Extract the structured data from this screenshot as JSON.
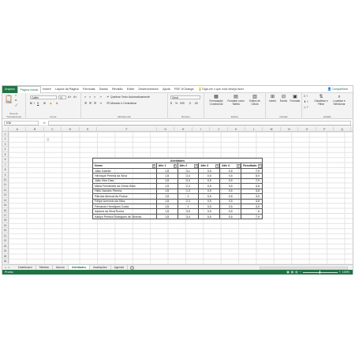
{
  "menu": {
    "file": "Arquivo",
    "tabs": [
      "Página Inicial",
      "Inserir",
      "Layout da Página",
      "Fórmulas",
      "Dados",
      "Revisão",
      "Exibir",
      "Desenvolvedor",
      "Ajuda",
      "PDF-XChange"
    ],
    "tell_me": "Diga-me o que você deseja fazer",
    "share": "Compartilhar"
  },
  "ribbon": {
    "paste": "Colar",
    "font_name": "Calibri",
    "font_size": "11",
    "wrap_text": "Quebrar Texto Automaticamente",
    "merge_center": "Mesclar e Centralizar",
    "number_format": "Geral",
    "conditional_format": "Formatação Condicional",
    "format_as_table": "Formatar como Tabela",
    "cell_styles": "Estilos de Célula",
    "insert": "Inserir",
    "delete": "Excluir",
    "format": "Formatar",
    "sort_filter": "Classificar e Filtrar",
    "find_select": "Localizar e Selecionar",
    "groups": [
      "Área de Transferência",
      "Fonte",
      "Alinhamento",
      "Número",
      "Estilos",
      "Células",
      "Edição"
    ]
  },
  "formula_bar": {
    "name_box": "K36",
    "fx": "fx",
    "content": ""
  },
  "columns": [
    "A",
    "B",
    "C",
    "D",
    "E",
    "F",
    "G",
    "H",
    "I",
    "J",
    "K",
    "L",
    "M",
    "N",
    "O",
    "P",
    "Q",
    "R",
    "S"
  ],
  "rows": [
    "1",
    "2",
    "3",
    "4",
    "5",
    "6",
    "7",
    "8",
    "9",
    "10",
    "11",
    "12",
    "13",
    "14",
    "15",
    "16",
    "17",
    "18",
    "19",
    "20",
    "21",
    "22",
    "23",
    "24",
    "25",
    "26"
  ],
  "sheet": {
    "title": "Atividades",
    "headers": [
      "Nome",
      "Ativ 1",
      "Ativ 2",
      "Ativ 3",
      "Ativ 4",
      "Resultado"
    ],
    "rows": [
      [
        "João Gabriel",
        "1,5",
        "3,1",
        "0,5",
        "0,5",
        "7,5"
      ],
      [
        "Henrique Pereira da Silva",
        "1,5",
        "3,4",
        "0,5",
        "0,5",
        "5,9"
      ],
      [
        "João Vitor Dias",
        "1,5",
        "3,4",
        "0,5",
        "0,5",
        "7,9"
      ],
      [
        "Maria Fernandes da Glória Silva",
        "1,5",
        "2,3",
        "0,5",
        "0,5",
        "4,8"
      ],
      [
        "Hélio Nandes Pereira",
        "1,5",
        "1,3",
        "0,5",
        "0,5",
        "3,8"
      ],
      [
        "Patrícia Alencar da Rocha",
        "1,5",
        "2",
        "0,5",
        "0,5",
        "4,5"
      ],
      [
        "Felipe Azevedo da Silva",
        "1,5",
        "2,3",
        "0,5",
        "0,5",
        "4,8"
      ],
      [
        "Fernando Henriques Costa",
        "1,5",
        "2",
        "0,5",
        "0,5",
        "4,5"
      ],
      [
        "Isadora da Silva Rocha",
        "1,5",
        "3,5",
        "0,5",
        "0,5",
        "6"
      ],
      [
        "Kaitlyn Pereira Rodrigues de Oliveira",
        "1,5",
        "3,4",
        "0,5",
        "0,5",
        "7,9"
      ]
    ]
  },
  "sheet_tabs": [
    "Dashboard",
    "Tabelas",
    "Alunos",
    "Atividades",
    "Avaliações",
    "Agenda"
  ],
  "active_sheet": "Atividades",
  "status": {
    "ready": "Pronto",
    "zoom": "100%"
  }
}
